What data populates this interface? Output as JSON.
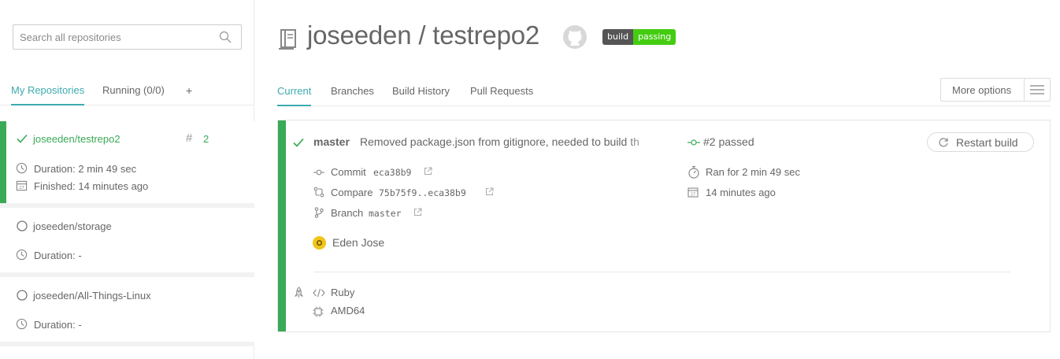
{
  "search": {
    "placeholder": "Search all repositories"
  },
  "sidebar_tabs": [
    {
      "label": "My Repositories"
    },
    {
      "label": "Running (0/0)"
    },
    {
      "label": "+"
    }
  ],
  "repos": [
    {
      "name": "joseeden/testrepo2",
      "build_number": "2",
      "duration": "Duration: 2 min 49 sec",
      "finished": "Finished: 14 minutes ago"
    },
    {
      "name": "joseeden/storage",
      "duration": "Duration: -"
    },
    {
      "name": "joseeden/All-Things-Linux",
      "duration": "Duration: -"
    }
  ],
  "header": {
    "title": "joseeden / testrepo2",
    "badge_left": "build",
    "badge_right": "passing"
  },
  "main_tabs": [
    {
      "label": "Current"
    },
    {
      "label": "Branches"
    },
    {
      "label": "Build History"
    },
    {
      "label": "Pull Requests"
    }
  ],
  "more_options": {
    "label": "More options"
  },
  "build": {
    "branch": "master",
    "message": "Removed package.json from gitignore, needed to build th",
    "status": "#2 passed",
    "restart_label": "Restart build",
    "commit_label": "Commit",
    "commit": "eca38b9",
    "compare_label": "Compare",
    "compare": "75b75f9..eca38b9",
    "branch_label": "Branch",
    "branch_value": "master",
    "author": "Eden Jose",
    "ran_for": "Ran for 2 min 49 sec",
    "ago": "14 minutes ago",
    "language": "Ruby",
    "arch": "AMD64"
  },
  "colors": {
    "passed": "#39aa56",
    "accent": "#3eaaaf"
  }
}
